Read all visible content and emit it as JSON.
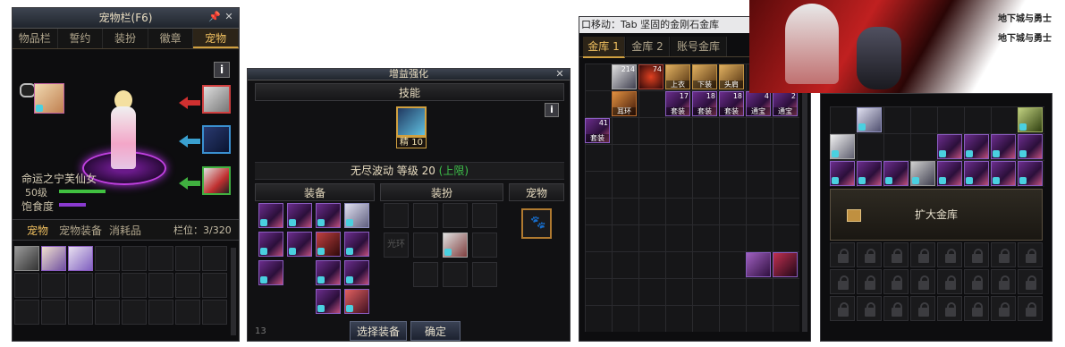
{
  "panel1": {
    "title": "宠物栏(F6)",
    "tabs": [
      "物品栏",
      "誓约",
      "装扮",
      "徽章",
      "宠物"
    ],
    "active_tab": 4,
    "info_icon": "i",
    "pet_name": "命运之宁芙仙女",
    "level": "50级",
    "hunger_label": "饱食度",
    "subtabs": [
      "宠物",
      "宠物装备",
      "消耗品"
    ],
    "slot_text": "栏位：3/320"
  },
  "panel2": {
    "title": "增益强化",
    "skill_header": "技能",
    "skill_badge": "精 10",
    "skill_line": "无尽波动 等级 20",
    "skill_max": "(上限)",
    "info_icon": "i",
    "sections": [
      "装备",
      "装扮",
      "宠物"
    ],
    "outfit_slot_label": "光环",
    "select_button": "选择装备",
    "confirm_button": "确定",
    "bottom_fragment": "13"
  },
  "panel3": {
    "header_text": "口移动：Tab  坚固的金刚石金库",
    "tabs": [
      "金库 1",
      "金库 2",
      "账号金库"
    ],
    "active_tab": 0,
    "items_row1": [
      {
        "cnt": "214",
        "lbl": ""
      },
      {
        "cnt": "74",
        "lbl": ""
      },
      {
        "cnt": "",
        "lbl": "上衣"
      },
      {
        "cnt": "",
        "lbl": "下装"
      },
      {
        "cnt": "",
        "lbl": "头肩"
      }
    ],
    "items_row2": [
      {
        "cnt": "",
        "lbl": "耳环"
      },
      {
        "cnt": "17",
        "lbl": "套装"
      },
      {
        "cnt": "18",
        "lbl": "套装"
      },
      {
        "cnt": "18",
        "lbl": "套装"
      },
      {
        "cnt": "4",
        "lbl": "通宝"
      },
      {
        "cnt": "2",
        "lbl": "通宝"
      }
    ],
    "item_row3": {
      "cnt": "41",
      "lbl": "套装"
    }
  },
  "panel4": {
    "banner_text": [
      "地下城与勇士",
      "地下城与勇士"
    ],
    "expand_button": "扩大金库"
  },
  "colors": {
    "panel_bg": "#0d0d0f",
    "accent_gold": "#f0c060",
    "skill_max_green": "#3ec04a",
    "arrow_red": "#d03030",
    "arrow_blue": "#3aa0d0",
    "arrow_green": "#40b040"
  }
}
